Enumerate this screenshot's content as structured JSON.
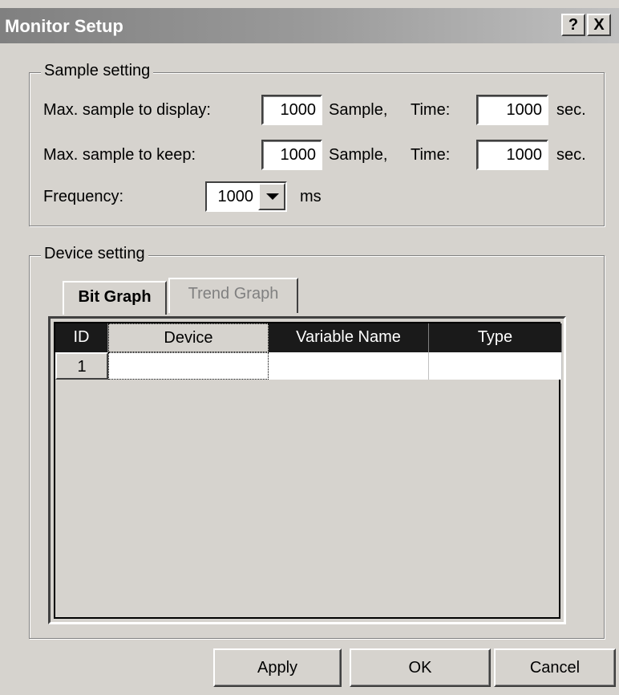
{
  "window": {
    "title": "Monitor Setup",
    "help_glyph": "?",
    "close_glyph": "X"
  },
  "sample_setting": {
    "legend": "Sample setting",
    "display_label": "Max. sample to display:",
    "display_value": "1000",
    "keep_label": "Max. sample to keep:",
    "keep_value": "1000",
    "sample_unit": "Sample,",
    "time_label": "Time:",
    "display_time": "1000",
    "keep_time": "1000",
    "sec_unit": "sec.",
    "frequency_label": "Frequency:",
    "frequency_value": "1000",
    "ms_unit": "ms"
  },
  "device_setting": {
    "legend": "Device setting",
    "tabs": [
      "Bit Graph",
      "Trend Graph"
    ],
    "columns": [
      "ID",
      "Device",
      "Variable Name",
      "Type"
    ],
    "rows": [
      {
        "id": "1",
        "device": "",
        "variable_name": "",
        "type": ""
      }
    ]
  },
  "buttons": {
    "apply": "Apply",
    "ok": "OK",
    "cancel": "Cancel"
  },
  "icons": {
    "help": "help-icon",
    "close": "close-icon",
    "dropdown": "chevron-down-icon"
  }
}
